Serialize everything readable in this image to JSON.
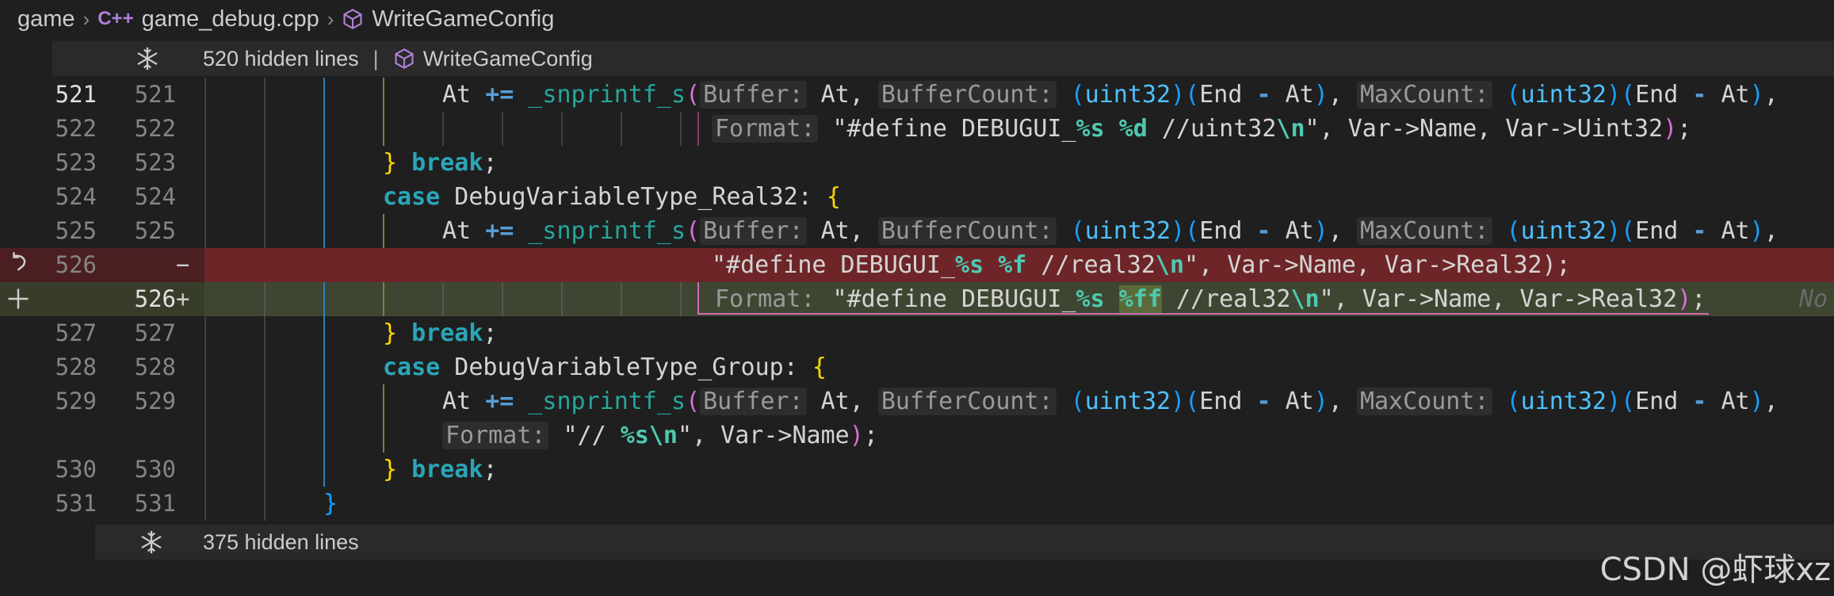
{
  "breadcrumb": {
    "items": [
      {
        "label": "game"
      },
      {
        "icon": "cpp-file-icon",
        "icon_text": "C++",
        "label": "game_debug.cpp"
      },
      {
        "icon": "cube-icon",
        "label": "WriteGameConfig"
      }
    ]
  },
  "folds": {
    "top": {
      "icon": "unfold-snowflake-icon",
      "text": "520 hidden lines",
      "separator": "|",
      "symbol_icon": "cube-icon",
      "symbol": "WriteGameConfig"
    },
    "bottom": {
      "icon": "unfold-snowflake-icon",
      "text": "375 hidden lines"
    }
  },
  "gutter_icons": [
    "revert-icon",
    "stage-plus-icon"
  ],
  "lines": [
    {
      "left": "521",
      "right": "521",
      "active": true
    },
    {
      "left": "522",
      "right": "522"
    },
    {
      "left": "523",
      "right": "523"
    },
    {
      "left": "524",
      "right": "524"
    },
    {
      "left": "525",
      "right": "525"
    },
    {
      "left": "526",
      "right": "",
      "marker": "−"
    },
    {
      "left": "",
      "right": "526",
      "marker": "+"
    },
    {
      "left": "527",
      "right": "527"
    },
    {
      "left": "528",
      "right": "528"
    },
    {
      "left": "529",
      "right": "529"
    },
    {
      "left": "",
      "right": ""
    },
    {
      "left": "530",
      "right": "530"
    },
    {
      "left": "531",
      "right": "531"
    }
  ],
  "ghost_text": "No",
  "watermark": "CSDN @虾球xz",
  "colors": {
    "deleted_row": "#6e2528",
    "added_row": "#3e4631",
    "background": "#1f1f1f"
  }
}
